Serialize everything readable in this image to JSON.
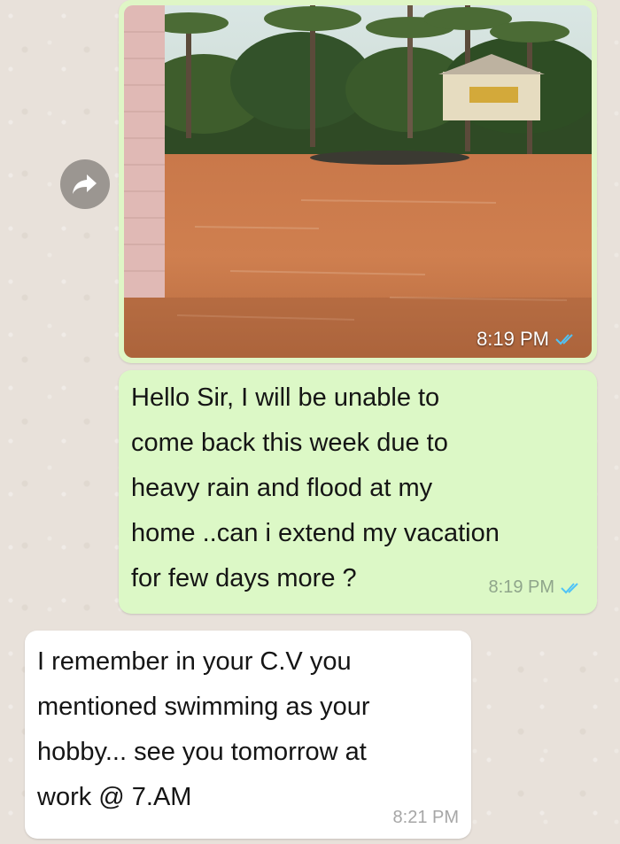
{
  "messages": {
    "image_message": {
      "time": "8:19 PM",
      "status_icon": "double-check-icon",
      "forward_icon": "forward-arrow-icon"
    },
    "sent_text": {
      "text": "Hello Sir, I will be unable to\ncome back this week due to\nheavy rain and flood at my\nhome ..can i extend my vacation\nfor few days more ?",
      "time": "8:19 PM",
      "status_icon": "double-check-icon"
    },
    "received_text": {
      "text": "I remember in your C.V you\nmentioned swimming as your\nhobby... see you tomorrow at\nwork @ 7.AM",
      "time": "8:21 PM"
    }
  },
  "colors": {
    "outgoing_bubble": "#dcf8c6",
    "incoming_bubble": "#ffffff",
    "read_receipt": "#4fc3f7"
  }
}
